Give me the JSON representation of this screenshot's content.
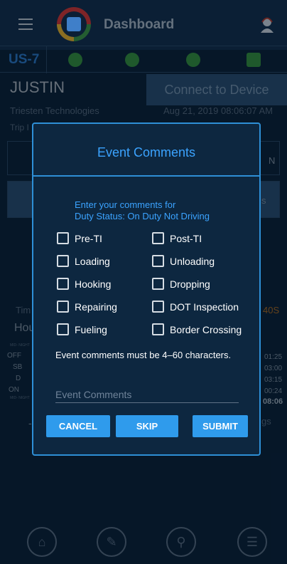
{
  "header": {
    "title": "Dashboard"
  },
  "unit_label": "US-7",
  "driver": {
    "name": "JUSTIN",
    "company": "Triesten Technologies",
    "trip_label": "Trip I"
  },
  "device": {
    "connect_label": "Connect to Device",
    "timestamp": "Aug 21, 2019 08:06:07 AM"
  },
  "background": {
    "partial_right_top": "N",
    "partial_right_mid": "s",
    "tim_label": "Tim",
    "hou_label": "Hou",
    "orange_time": "40S",
    "mid_night_top": "MID- NIGHT",
    "mid_night_bottom": "MID- NIGHT",
    "status_rows": [
      "OFF",
      "SB",
      "D",
      "ON"
    ],
    "durations": [
      "01:25",
      "03:00",
      "03:15",
      "00:24"
    ],
    "total": "08:06",
    "dash": "-",
    "logs_partial": "gs"
  },
  "dialog": {
    "title": "Event Comments",
    "prompt_line1": "Enter your comments for",
    "prompt_line2": "Duty Status: On Duty Not Driving",
    "options": [
      "Pre-TI",
      "Post-TI",
      "Loading",
      "Unloading",
      "Hooking",
      "Dropping",
      "Repairing",
      "DOT Inspection",
      "Fueling",
      "Border Crossing"
    ],
    "note": "Event comments must be 4–60 characters.",
    "field_placeholder": "Event Comments",
    "cancel_label": "CANCEL",
    "skip_label": "SKIP",
    "submit_label": "SUBMIT"
  },
  "icons": {
    "menu": "menu-icon",
    "agent": "headset-agent-icon",
    "driver": "driver-icon",
    "co_driver": "co-driver-icon",
    "sync": "sync-icon",
    "calendar": "calendar-icon",
    "home": "home-icon",
    "edit": "pencil-icon",
    "search": "search-icon",
    "list": "list-icon"
  },
  "colors": {
    "accent": "#2e8fd6",
    "button": "#2f9bec",
    "title_blue": "#3ba3ff",
    "background": "#0b2238"
  }
}
